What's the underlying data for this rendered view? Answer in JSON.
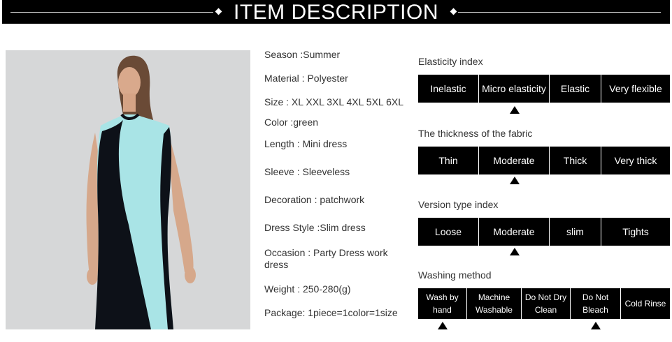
{
  "header": {
    "title": "ITEM DESCRIPTION"
  },
  "specs": [
    "Season :Summer",
    "Material : Polyester",
    "Size : XL XXL 3XL 4XL 5XL 6XL",
    "Color :green",
    "Length : Mini dress",
    "Sleeve : Sleeveless",
    "Decoration : patchwork",
    "Dress Style :Slim dress",
    "Occasion : Party Dress work dress",
    "Weight : 250-280(g)",
    "Package: 1piece=1color=1size"
  ],
  "scales": {
    "elasticity": {
      "title": "Elasticity index",
      "options": [
        "Inelastic",
        "Micro elasticity",
        "Elastic",
        "Very flexible"
      ],
      "selected": [
        1
      ]
    },
    "thickness": {
      "title": "The thickness of the fabric",
      "options": [
        "Thin",
        "Moderate",
        "Thick",
        "Very thick"
      ],
      "selected": [
        1
      ]
    },
    "version": {
      "title": "Version type index",
      "options": [
        "Loose",
        "Moderate",
        "slim",
        "Tights"
      ],
      "selected": [
        1
      ]
    },
    "washing": {
      "title": "Washing method",
      "options": [
        "Wash by hand",
        "Machine Washable",
        "Do Not Dry Clean",
        "Do Not Bleach",
        "Cold Rinse"
      ],
      "selected": [
        0,
        3
      ]
    }
  },
  "colors": {
    "header_bg": "#000000",
    "dress_light": "#a9e4e6",
    "dress_dark": "#0d1118"
  }
}
